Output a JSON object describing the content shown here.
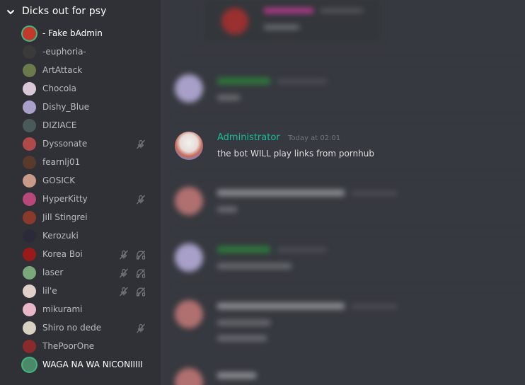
{
  "channel": {
    "name": "Dicks out for psy",
    "users": [
      {
        "name": "- Fake bAdmin",
        "active": true,
        "speaking": true,
        "muted": false,
        "deafened": false,
        "avatar_color": "#c0392b"
      },
      {
        "name": "-euphoria-",
        "active": false,
        "speaking": false,
        "muted": false,
        "deafened": false,
        "avatar_color": "#3a3a3a"
      },
      {
        "name": "ArtAttack",
        "active": false,
        "speaking": false,
        "muted": false,
        "deafened": false,
        "avatar_color": "#6b7a4a"
      },
      {
        "name": "Chocola",
        "active": false,
        "speaking": false,
        "muted": false,
        "deafened": false,
        "avatar_color": "#d8c8d8"
      },
      {
        "name": "Dishy_Blue",
        "active": false,
        "speaking": false,
        "muted": false,
        "deafened": false,
        "avatar_color": "#a8a0c8"
      },
      {
        "name": "DIZIACE",
        "active": false,
        "speaking": false,
        "muted": false,
        "deafened": false,
        "avatar_color": "#4a5a5a"
      },
      {
        "name": "Dyssonate",
        "active": false,
        "speaking": false,
        "muted": true,
        "deafened": false,
        "avatar_color": "#b04a4a"
      },
      {
        "name": "fearnlj01",
        "active": false,
        "speaking": false,
        "muted": false,
        "deafened": false,
        "avatar_color": "#5a3a2a"
      },
      {
        "name": "GOSICK",
        "active": false,
        "speaking": false,
        "muted": false,
        "deafened": false,
        "avatar_color": "#c89a8a"
      },
      {
        "name": "HyperKitty",
        "active": false,
        "speaking": false,
        "muted": true,
        "deafened": false,
        "avatar_color": "#b8487a"
      },
      {
        "name": "Jill Stingrei",
        "active": false,
        "speaking": false,
        "muted": false,
        "deafened": false,
        "avatar_color": "#8a3a2a"
      },
      {
        "name": "Kerozuki",
        "active": false,
        "speaking": false,
        "muted": false,
        "deafened": false,
        "avatar_color": "#2a2a3a"
      },
      {
        "name": "Korea Boi",
        "active": false,
        "speaking": false,
        "muted": true,
        "deafened": true,
        "avatar_color": "#9a1a1a"
      },
      {
        "name": "laser",
        "active": false,
        "speaking": false,
        "muted": true,
        "deafened": true,
        "avatar_color": "#7aa87a"
      },
      {
        "name": "lil'e",
        "active": false,
        "speaking": false,
        "muted": true,
        "deafened": true,
        "avatar_color": "#e0d0c8"
      },
      {
        "name": "mikurami",
        "active": false,
        "speaking": false,
        "muted": false,
        "deafened": false,
        "avatar_color": "#e8b8c8"
      },
      {
        "name": "Shiro no dede",
        "active": false,
        "speaking": false,
        "muted": true,
        "deafened": false,
        "avatar_color": "#d8d0c0"
      },
      {
        "name": "ThePoorOne",
        "active": false,
        "speaking": false,
        "muted": false,
        "deafened": false,
        "avatar_color": "#8a2a2a"
      },
      {
        "name": "WAGA NA WA NICONIIIII",
        "active": true,
        "speaking": true,
        "muted": false,
        "deafened": false,
        "avatar_color": "#4a8a6a"
      }
    ]
  },
  "chat": {
    "messages": [
      {
        "author": "Administrator",
        "author_color": "#1abc9c",
        "timestamp": "Today at 02:01",
        "text": "the bot WILL play links from pornhub"
      }
    ]
  },
  "colors": {
    "sidebar_bg": "#2f3136",
    "chat_bg": "#36393f",
    "speaking_ring": "#43b581",
    "icon_gray": "#72767d"
  }
}
